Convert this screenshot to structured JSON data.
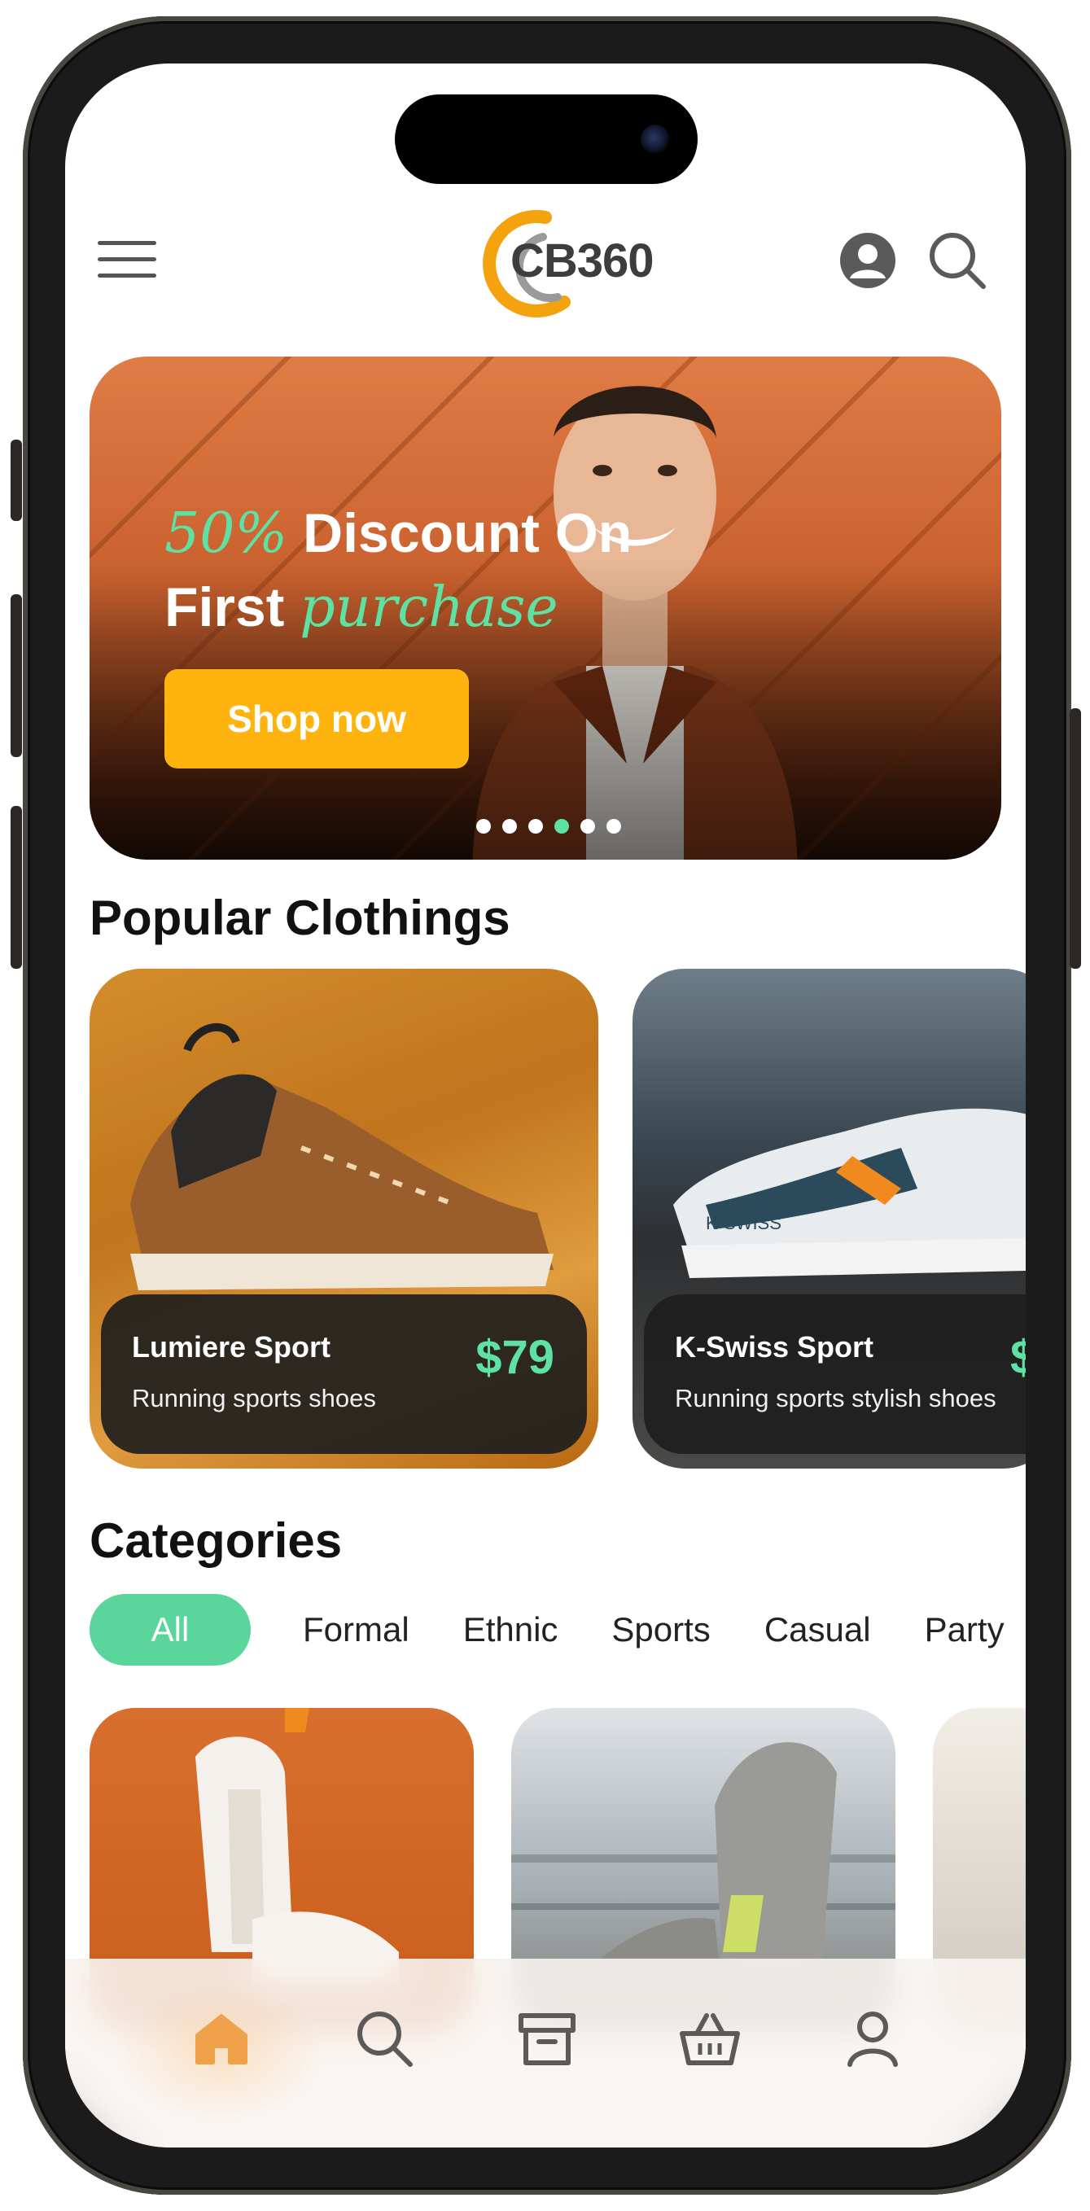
{
  "header": {
    "logo_text": "CB360",
    "menu_icon": "hamburger-menu-icon",
    "profile_icon": "user-avatar-icon",
    "search_icon": "search-icon"
  },
  "banner": {
    "title_accent_1": "50%",
    "title_rest_1": "Discount On",
    "title_rest_2": "First",
    "title_accent_2": "purchase",
    "button_label": "Shop now",
    "slide_count": 6,
    "active_slide": 4
  },
  "popular": {
    "title": "Popular Clothings",
    "products": [
      {
        "name": "Lumiere Sport",
        "desc": "Running sports shoes",
        "price": "$79"
      },
      {
        "name": "K-Swiss Sport",
        "desc": "Running sports stylish shoes",
        "price": "$"
      }
    ]
  },
  "categories": {
    "title": "Categories",
    "chips": [
      "All",
      "Formal",
      "Ethnic",
      "Sports",
      "Casual",
      "Party"
    ],
    "active": "All"
  },
  "bottom_nav": {
    "items": [
      "home-icon",
      "search-icon",
      "archive-icon",
      "basket-icon",
      "profile-icon"
    ],
    "active": "home-icon"
  },
  "colors": {
    "accent_green": "#5ee2a4",
    "accent_yellow": "#ffb30f",
    "nav_active": "#f0a24a",
    "nav_inactive": "#5a5a5a"
  }
}
